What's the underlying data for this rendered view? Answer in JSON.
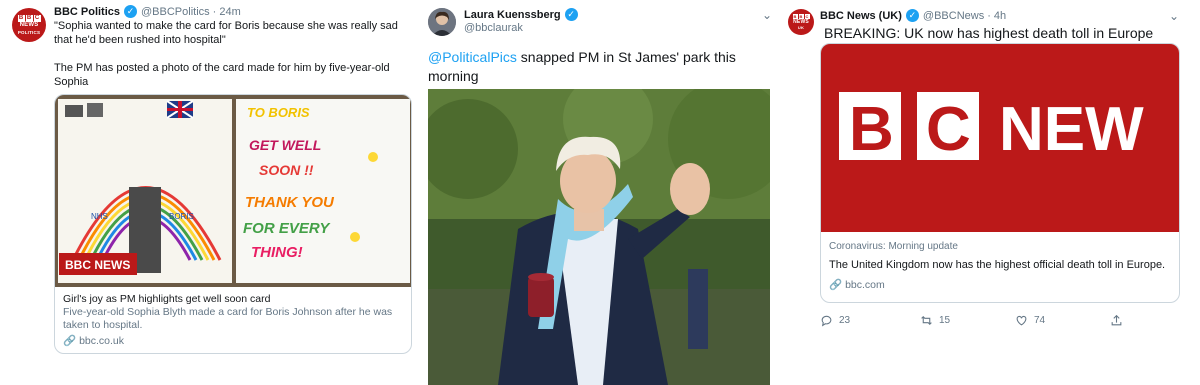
{
  "tweet1": {
    "avatar_top": "BBC",
    "avatar_mid": "NEWS",
    "avatar_bot": "POLITICS",
    "name": "BBC Politics",
    "handle": "@BBCPolitics",
    "time": "· 24m",
    "quote": "\"Sophia wanted to make the card for Boris because she was really sad that he'd been rushed into hospital\"",
    "body": "The PM has posted a photo of the card made for him by five-year-old Sophia",
    "card": {
      "left_page_labels": [
        "NHS",
        "BORIS"
      ],
      "right_page_lines": [
        "TO BORIS",
        "GET WELL",
        "SOON !!",
        "THANK YOU",
        "FOR EVERY",
        "THING!"
      ],
      "bbc_news_logo": "BBC NEWS",
      "title": "Girl's joy as PM highlights get well soon card",
      "description": "Five-year-old Sophia Blyth made a card for Boris Johnson after he was taken to hospital.",
      "link": "bbc.co.uk"
    }
  },
  "tweet2": {
    "name": "Laura Kuenssberg",
    "handle": "@bbclaurak",
    "mention": "@PoliticalPics",
    "body": " snapped PM in St James' park this morning"
  },
  "tweet3": {
    "avatar_top": "BBC",
    "avatar_mid": "NEWS",
    "avatar_bot": "UK",
    "name": "BBC News (UK)",
    "handle": "@BBCNews",
    "time": "· 4h",
    "headline": "BREAKING: UK now has highest death toll in Europe",
    "card": {
      "logo_letters": [
        "B",
        "C",
        "NEW"
      ],
      "category": "Coronavirus: Morning update",
      "summary": "The United Kingdom now has the highest official death toll in Europe.",
      "link": "bbc.com"
    },
    "actions": {
      "replies": "23",
      "retweets": "15",
      "likes": "74"
    }
  },
  "colors": {
    "bbc_red": "#bb1919",
    "twitter_blue": "#1da1f2",
    "muted": "#657786"
  }
}
